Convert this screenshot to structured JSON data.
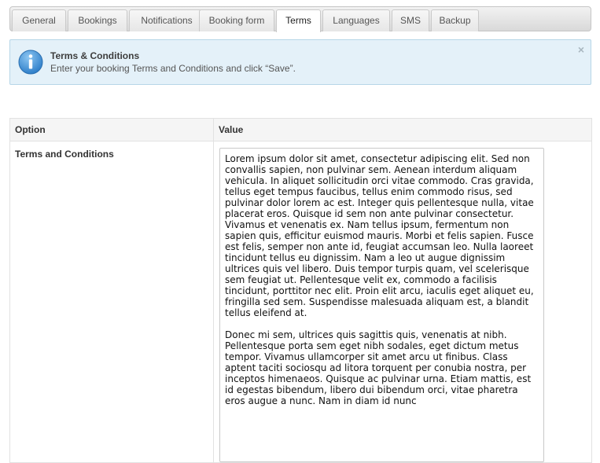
{
  "tabs": [
    {
      "label": "General",
      "active": false
    },
    {
      "label": "Bookings",
      "active": false
    },
    {
      "label": "Notifications",
      "active": false
    },
    {
      "label": "Booking form",
      "active": false
    },
    {
      "label": "Terms",
      "active": true
    },
    {
      "label": "Languages",
      "active": false
    },
    {
      "label": "SMS",
      "active": false
    },
    {
      "label": "Backup",
      "active": false
    }
  ],
  "notice": {
    "title": "Terms & Conditions",
    "text": "Enter your booking Terms and Conditions and click “Save”.",
    "icon": "info-icon",
    "close_icon": "×"
  },
  "table": {
    "headers": {
      "option": "Option",
      "value": "Value"
    },
    "rows": [
      {
        "label": "Terms and Conditions",
        "value": "Lorem ipsum dolor sit amet, consectetur adipiscing elit. Sed non convallis sapien, non pulvinar sem. Aenean interdum aliquam vehicula. In aliquet sollicitudin orci vitae commodo. Cras gravida, tellus eget tempus faucibus, tellus enim commodo risus, sed pulvinar dolor lorem ac est. Integer quis pellentesque nulla, vitae placerat eros. Quisque id sem non ante pulvinar consectetur. Vivamus et venenatis ex. Nam tellus ipsum, fermentum non sapien quis, efficitur euismod mauris. Morbi et felis sapien. Fusce est felis, semper non ante id, feugiat accumsan leo. Nulla laoreet tincidunt tellus eu dignissim. Nam a leo ut augue dignissim ultrices quis vel libero. Duis tempor turpis quam, vel scelerisque sem feugiat ut. Pellentesque velit ex, commodo a facilisis tincidunt, porttitor nec elit. Proin elit arcu, iaculis eget aliquet eu, fringilla sed sem. Suspendisse malesuada aliquam est, a blandit tellus eleifend at.\n\nDonec mi sem, ultrices quis sagittis quis, venenatis at nibh. Pellentesque porta sem eget nibh sodales, eget dictum metus tempor. Vivamus ullamcorper sit amet arcu ut finibus. Class aptent taciti sociosqu ad litora torquent per conubia nostra, per inceptos himenaeos. Quisque ac pulvinar urna. Etiam mattis, est id egestas bibendum, libero dui bibendum orci, vitae pharetra eros augue a nunc. Nam in diam id nunc"
      }
    ]
  },
  "colors": {
    "notice_bg": "#e4f1f9",
    "notice_border": "#b7d6e8",
    "info_icon_blue": "#3b8fd6"
  }
}
